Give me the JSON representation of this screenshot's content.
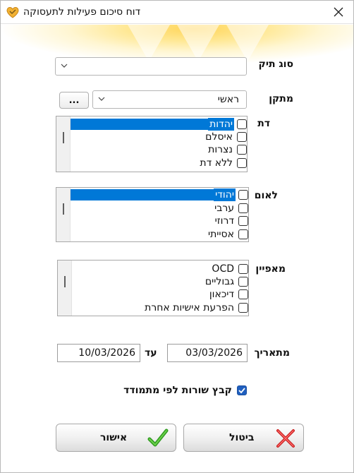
{
  "window": {
    "title": "דוח סיכום פעילות לתעסוקה",
    "accent": "#0078d7"
  },
  "fields": {
    "case_type": {
      "label": "סוג תיק",
      "value": ""
    },
    "facility": {
      "label": "מתקן",
      "value": "ראשי",
      "browse_label": "..."
    },
    "religion": {
      "label": "דת",
      "items": [
        {
          "text": "יהדות",
          "selected": true
        },
        {
          "text": "איסלם",
          "selected": false
        },
        {
          "text": "נצרות",
          "selected": false
        },
        {
          "text": "ללא דת",
          "selected": false
        }
      ]
    },
    "nationality": {
      "label": "לאום",
      "items": [
        {
          "text": "יהודי",
          "selected": true
        },
        {
          "text": "ערבי",
          "selected": false
        },
        {
          "text": "דרוזי",
          "selected": false
        },
        {
          "text": "אסייתי",
          "selected": false
        }
      ]
    },
    "characteristic": {
      "label": "מאפיין",
      "items": [
        {
          "text": "OCD",
          "selected": false
        },
        {
          "text": "גבוליים",
          "selected": false
        },
        {
          "text": "דיכאון",
          "selected": false
        },
        {
          "text": "הפרעת אישיות אחרת",
          "selected": false
        }
      ]
    },
    "date_range": {
      "from_label": "מתאריך",
      "from_value": "03/03/2026",
      "to_label": "עד",
      "to_value": "10/03/2026"
    },
    "group_by_coach": {
      "label": "קבץ שורות לפי מתמודד",
      "checked": true
    }
  },
  "buttons": {
    "ok_label": "אישור",
    "cancel_label": "ביטול"
  }
}
